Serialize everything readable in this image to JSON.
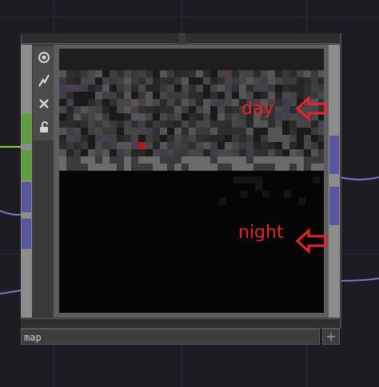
{
  "node": {
    "name": "map",
    "add_label": "+"
  },
  "toolbar": {
    "buttons": [
      {
        "name": "viewer-toggle",
        "icon": "ring-icon"
      },
      {
        "name": "bypass",
        "icon": "lightning-icon"
      },
      {
        "name": "close",
        "icon": "x-icon"
      },
      {
        "name": "lock",
        "icon": "lock-icon"
      }
    ]
  },
  "annotations": {
    "day": "day",
    "night": "night"
  },
  "colors": {
    "annotation": "#e8232a",
    "wire_green": "#8fd14f",
    "wire_purple": "#7b75c8",
    "connector_green": "#5d9e3c",
    "connector_purple": "#5a55a0"
  }
}
